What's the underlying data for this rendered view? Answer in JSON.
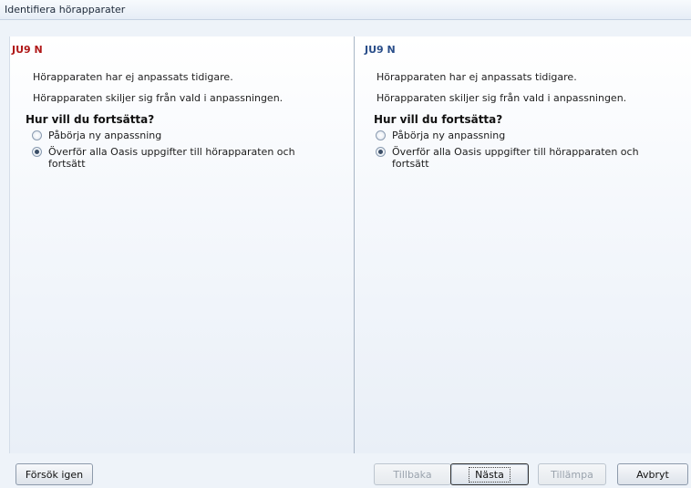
{
  "window": {
    "title": "Identifiera hörapparater"
  },
  "panels": [
    {
      "header": "JU9 N",
      "line1": "Hörapparaten har ej anpassats tidigare.",
      "line2": "Hörapparaten skiljer sig från vald i anpassningen.",
      "question": "Hur vill du fortsätta?",
      "options": [
        {
          "label": "Påbörja ny anpassning",
          "checked": false
        },
        {
          "label": "Överför alla Oasis uppgifter till hörapparaten och fortsätt",
          "checked": true
        }
      ]
    },
    {
      "header": "JU9 N",
      "line1": "Hörapparaten har ej anpassats tidigare.",
      "line2": "Hörapparaten skiljer sig från vald i anpassningen.",
      "question": "Hur vill du fortsätta?",
      "options": [
        {
          "label": "Påbörja ny anpassning",
          "checked": false
        },
        {
          "label": "Överför alla Oasis uppgifter till hörapparaten och fortsätt",
          "checked": true
        }
      ]
    }
  ],
  "buttons": {
    "retry": "Försök igen",
    "back": "Tillbaka",
    "next": "Nästa",
    "apply": "Tillämpa",
    "cancel": "Avbryt"
  }
}
